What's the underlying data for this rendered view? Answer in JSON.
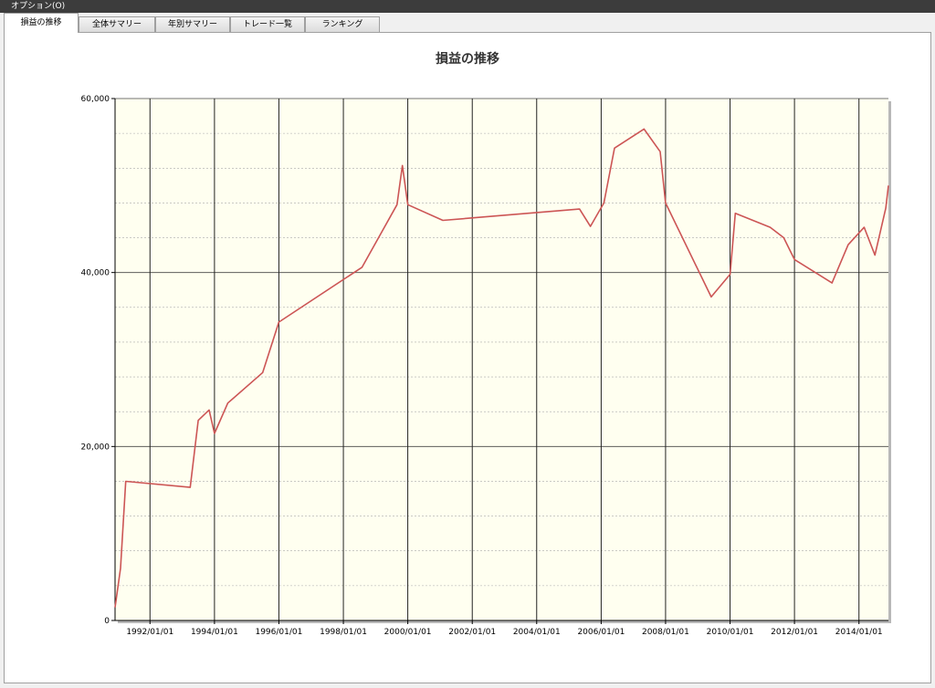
{
  "menu": {
    "option_label": "オプション(O)"
  },
  "tabs": [
    {
      "label": "損益の推移",
      "active": true
    },
    {
      "label": "全体サマリー",
      "active": false
    },
    {
      "label": "年別サマリー",
      "active": false
    },
    {
      "label": "トレード一覧",
      "active": false
    },
    {
      "label": "ランキング",
      "active": false
    }
  ],
  "colors": {
    "line": "#cc5555",
    "plot_bg": "#fffff0",
    "menubar": "#3c3c3c"
  },
  "chart_data": {
    "type": "line",
    "title": "損益の推移",
    "xlabel": "",
    "ylabel": "",
    "x_range": [
      "1990/12/01",
      "2014/12/01"
    ],
    "ylim": [
      0,
      60000
    ],
    "y_ticks": [
      0,
      20000,
      40000,
      60000
    ],
    "y_tick_labels": [
      "0",
      "20,000",
      "40,000",
      "60,000"
    ],
    "x_ticks": [
      "1992/01/01",
      "1994/01/01",
      "1996/01/01",
      "1998/01/01",
      "2000/01/01",
      "2002/01/01",
      "2004/01/01",
      "2006/01/01",
      "2008/01/01",
      "2010/01/01",
      "2012/01/01",
      "2014/01/01"
    ],
    "grid": true,
    "series": [
      {
        "x": [
          "1990/12/01",
          "1991/02/01",
          "1991/04/01",
          "1993/04/01",
          "1993/07/01",
          "1993/11/01",
          "1994/01/01",
          "1994/06/01",
          "1995/07/01",
          "1996/01/01",
          "1998/08/01",
          "1999/09/01",
          "1999/11/01",
          "2000/01/01",
          "2001/02/01",
          "2005/05/01",
          "2005/09/01",
          "2006/02/01",
          "2006/06/01",
          "2007/05/01",
          "2007/11/01",
          "2008/01/01",
          "2009/06/01",
          "2010/01/01",
          "2010/03/01",
          "2011/04/01",
          "2011/09/01",
          "2012/01/01",
          "2013/03/01",
          "2013/09/01",
          "2014/03/01",
          "2014/07/01",
          "2014/11/01",
          "2015/02/01"
        ],
        "y": [
          1500,
          6000,
          16000,
          15300,
          23000,
          24200,
          21500,
          25000,
          28500,
          34300,
          40600,
          47800,
          52300,
          47800,
          46000,
          47300,
          45300,
          48000,
          54300,
          56500,
          53900,
          48000,
          37200,
          39800,
          46800,
          45200,
          44000,
          41500,
          38800,
          43200,
          45200,
          42000,
          47400,
          50000
        ]
      }
    ]
  }
}
